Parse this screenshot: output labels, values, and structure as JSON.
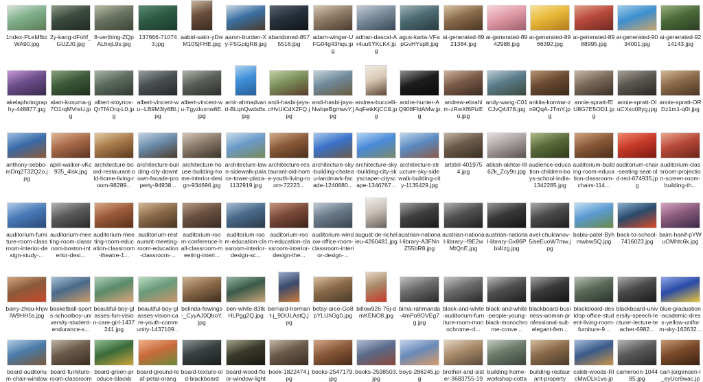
{
  "files": [
    {
      "name": "1ndex-PLeMfbzWA90.jpg",
      "colors": [
        "#7fb08a",
        "#d9e3d8",
        "#5e7b58"
      ]
    },
    {
      "name": "2y-kang-dFohf_GUZJ0.jpg",
      "colors": [
        "#3b4a3f",
        "#8d9c86",
        "#1f2a24"
      ]
    },
    {
      "name": "8-verthing-ZQpALhxjL9s.jpg",
      "colors": [
        "#6b7462",
        "#b9bca6",
        "#3c4436"
      ]
    },
    {
      "name": "137666-710743.jpg",
      "colors": [
        "#2e5b45",
        "#5a8a72",
        "#1b3b2d"
      ]
    },
    {
      "name": "aabid-sakir-yDwM10SjFHE.jpg",
      "colors": [
        "#6b4e3c",
        "#c8b79e",
        "#3b2b22"
      ],
      "tall": true
    },
    {
      "name": "aaron-burden-Xy-F5GptgR8.jpg",
      "colors": [
        "#3a6fa1",
        "#c8d8e6",
        "#4b3a2b"
      ]
    },
    {
      "name": "abandoned-8575516.jpg",
      "colors": [
        "#26313b",
        "#5a6570",
        "#0f1418"
      ]
    },
    {
      "name": "adam-winger-UFG04g43hqs.jpg",
      "colors": [
        "#8f7b66",
        "#d7c9b4",
        "#4a3b2e"
      ]
    },
    {
      "name": "adrian-dascal-Ar4uu5YKLK4.jpg",
      "colors": [
        "#7a8c9c",
        "#c3ccd4",
        "#394754"
      ]
    },
    {
      "name": "agus-karta-VFapGvHYsp8.jpg",
      "colors": [
        "#4d6b73",
        "#9fb3b7",
        "#27393d"
      ]
    },
    {
      "name": "ai-generated-8921384.jpg",
      "colors": [
        "#8a6b4c",
        "#d9c4a4",
        "#493522"
      ]
    },
    {
      "name": "ai-generated-8942988.jpg",
      "colors": [
        "#e09aa8",
        "#f5d6dc",
        "#9e5e6b"
      ]
    },
    {
      "name": "ai-generated-8966392.jpg",
      "colors": [
        "#e8b93a",
        "#f6e19a",
        "#b07a1c"
      ]
    },
    {
      "name": "ai-generated-8988995.jpg",
      "colors": [
        "#b94a3c",
        "#e3a08c",
        "#6e2a22"
      ]
    },
    {
      "name": "ai-generated-9034001.jpg",
      "colors": [
        "#3d8fd0",
        "#9fcde8",
        "#c8a46a"
      ]
    },
    {
      "name": "ai-generated-9214143.jpg",
      "colors": [
        "#4a6b3a",
        "#9ab07e",
        "#2c3d22"
      ]
    },
    {
      "name": "akelaphotography-448877.jpg",
      "colors": [
        "#6b4d8a",
        "#c79ad6",
        "#3b2a4e"
      ]
    },
    {
      "name": "alam-kusuma-g7O1rqMVreU.jpg",
      "colors": [
        "#3c5a3a",
        "#8aa47a",
        "#1f2e1c"
      ]
    },
    {
      "name": "albert-stoynov-QrTfAOrq-L0.jpg",
      "colors": [
        "#5c6a5e",
        "#a9b5a6",
        "#2e3830"
      ]
    },
    {
      "name": "albert-vincent-wu--LB9M3ly8BI.jpg",
      "colors": [
        "#4a4f52",
        "#9aa0a2",
        "#26292b"
      ]
    },
    {
      "name": "albert-vincent-wu-Tgyzloxnw6E.jpg",
      "colors": [
        "#5a5e58",
        "#b0b4aa",
        "#2b2e2a"
      ]
    },
    {
      "name": "amir-ahmadvand-BLqnQwds6s.jpg",
      "colors": [
        "#3f8fd8",
        "#a9d2f2",
        "#2a5f99"
      ],
      "tall": true
    },
    {
      "name": "andi-hasbi-jaya-cHvUiCdX2FQ.jpg",
      "colors": [
        "#7a8f5a",
        "#c5d1a6",
        "#5a3b2a"
      ]
    },
    {
      "name": "andi-hasbi-jaya-NwIqeBgmwvY.jpg",
      "colors": [
        "#6f8a9a",
        "#c6d4da",
        "#6a5a3e"
      ]
    },
    {
      "name": "andrea-buccelli-AqFetkKjCC8.jpg",
      "colors": [
        "#d9c8b4",
        "#f2ece4",
        "#5a4436"
      ],
      "tall": true
    },
    {
      "name": "andre-hunter-AQ908FfdAMw.jpg",
      "colors": [
        "#1c1c1c",
        "#8f8f8f",
        "#0a0a0a"
      ]
    },
    {
      "name": "andrew-ebrahim-zRwXf6PizEo.jpg",
      "colors": [
        "#7a5a48",
        "#cfb6a0",
        "#3a2a20"
      ]
    },
    {
      "name": "andy-wang-C01CJvQ4478.jpg",
      "colors": [
        "#5a7a8a",
        "#b8cbd4",
        "#3a4a3a"
      ]
    },
    {
      "name": "ankita-konwar-zn9QqA-JTmY.jpg",
      "colors": [
        "#6a4a32",
        "#b89470",
        "#3a2818"
      ]
    },
    {
      "name": "annie-spratt-fEU8G7E5OD1.jpg",
      "colors": [
        "#7a6a5a",
        "#cabaa8",
        "#3a2e24"
      ]
    },
    {
      "name": "annie-spratt-OIuCXxo08yg.jpg",
      "colors": [
        "#5a5650",
        "#a8a298",
        "#2a2622"
      ]
    },
    {
      "name": "annie-spratt-ORDz1m1-q0I.jpg",
      "colors": [
        "#8a6a4a",
        "#d4b896",
        "#4a3422"
      ]
    },
    {
      "name": "anthony-sebbo-mDrq2T32Q2o.jpg",
      "colors": [
        "#3a6aa8",
        "#9cc0e4",
        "#8a5a3a"
      ]
    },
    {
      "name": "april-walker-vKc935_4lsk.jpg",
      "colors": [
        "#a86a4a",
        "#e0b898",
        "#5a3422"
      ]
    },
    {
      "name": "architecture-board-restaurant-old-home-living-room-98289...",
      "colors": [
        "#a87a4a",
        "#e4cba4",
        "#5a3a1e"
      ]
    },
    {
      "name": "architecture-building-city-downtown-facade-property-94938...",
      "colors": [
        "#6a8aa8",
        "#c4d4e2",
        "#4a3a2a"
      ]
    },
    {
      "name": "architecture-house-building-home-interior-design-934696.jpg",
      "colors": [
        "#8a7a6a",
        "#d4c8b8",
        "#3a322a"
      ]
    },
    {
      "name": "architecture-lawn-sidewalk-palace-tower-plaza-1132919.jpg",
      "colors": [
        "#6a9ac8",
        "#c8dcec",
        "#7a8a5a"
      ]
    },
    {
      "name": "architecture-restaurant-old-home-youth-living-room-72223...",
      "colors": [
        "#8a5a3a",
        "#d4ae8a",
        "#4a2e1a"
      ]
    },
    {
      "name": "architecture-sky-building-chateau-landmark-facade-1240880...",
      "colors": [
        "#3a72c8",
        "#a6c8ee",
        "#6a5a4a"
      ]
    },
    {
      "name": "architecture-sky-building-city-skyscraper-cityscape-1346767...",
      "colors": [
        "#4a8ad8",
        "#b4d4f4",
        "#7a8a6a"
      ]
    },
    {
      "name": "architecture-structure-sky-sidewalk-building-city-1135429.jpg",
      "colors": [
        "#5a8ac0",
        "#c0d6ea",
        "#8a5a4a"
      ]
    },
    {
      "name": "artstel-4019754.jpg",
      "colors": [
        "#6a5a4a",
        "#c4b4a0",
        "#3a2e22"
      ]
    },
    {
      "name": "atikah-akhtar-I862k_Zcy9o.jpg",
      "colors": [
        "#a8a0a0",
        "#e4e0de",
        "#5a5050"
      ]
    },
    {
      "name": "audience-education-children-boys-school-india-1342285.jpg",
      "colors": [
        "#5a6a3a",
        "#aebc88",
        "#2e3a1a"
      ]
    },
    {
      "name": "auditorium-building-room-education-classroom-chairs-114...",
      "colors": [
        "#8a5a3a",
        "#d4a480",
        "#4a2c18"
      ]
    },
    {
      "name": "auditorium-chair-seating-seat-old-red-674935.jpg",
      "colors": [
        "#c83a2a",
        "#f08a6e",
        "#7a1a10"
      ]
    },
    {
      "name": "auditorium-classroom-projection-screen-room-building-th...",
      "colors": [
        "#b84a3a",
        "#e8a890",
        "#6a2418"
      ]
    },
    {
      "name": "auditorium-furniture-room-classroom-interior-design-study-...",
      "colors": [
        "#4a7ab8",
        "#b0cce8",
        "#2a4a78"
      ]
    },
    {
      "name": "auditorium-meeting-room-classroom-boston-interior-desi...",
      "colors": [
        "#5a5a5a",
        "#b4b4b4",
        "#2a2a2a"
      ]
    },
    {
      "name": "auditorium-meeting-room-education-classroom-theatre-1...",
      "colors": [
        "#9a5a3a",
        "#dca888",
        "#5a3018"
      ]
    },
    {
      "name": "auditorium-restaurant-meeting-room-education-classroom-...",
      "colors": [
        "#8a6a4a",
        "#d4b894",
        "#4a3420"
      ]
    },
    {
      "name": "auditorium-room-conference-hall-classroom-meeting-interi...",
      "colors": [
        "#6a5040",
        "#b89c88",
        "#3a2a20"
      ]
    },
    {
      "name": "auditorium-room-education-classroom-interior-design-sc...",
      "colors": [
        "#4a6a8a",
        "#a6bcd2",
        "#2a3a4a"
      ]
    },
    {
      "name": "auditorium-room-education-classroom-interior-design-the...",
      "colors": [
        "#7a4a3a",
        "#c8967e",
        "#3e2218"
      ]
    },
    {
      "name": "auditorium-window-office-room-classroom-interior-design-...",
      "colors": [
        "#6a7a8a",
        "#c0cad4",
        "#3a4450"
      ]
    },
    {
      "name": "august-de-richelieu-4260481.jpg",
      "colors": [
        "#c8c0b8",
        "#f0ece8",
        "#6a6058"
      ],
      "tall": true
    },
    {
      "name": "austrian-national-library-A3FNnZ55bR8.jpg",
      "colors": [
        "#404040",
        "#a0a0a0",
        "#1a1a1a"
      ]
    },
    {
      "name": "austrian-national-library--f9E2wMtQnE.jpg",
      "colors": [
        "#505050",
        "#b0b0b0",
        "#202020"
      ]
    },
    {
      "name": "austrian-national-library-Gx86Pbi4Izg.jpg",
      "colors": [
        "#383838",
        "#989898",
        "#141414"
      ]
    },
    {
      "name": "avel-chuklanov-5iseEuoW7mw.jpg",
      "colors": [
        "#4a4a4a",
        "#aaaaaa",
        "#1e1e1e"
      ]
    },
    {
      "name": "bablu-patel-ByhmwbwSQ.jpg",
      "colors": [
        "#5a9ad0",
        "#c4e0f4",
        "#6a8a4a"
      ]
    },
    {
      "name": "back-to-school-7416023.jpg",
      "colors": [
        "#2a4a6a",
        "#8ab0d0",
        "#d84a2a"
      ]
    },
    {
      "name": "baim-hanif-pYWuOMhtc6k.jpg",
      "colors": [
        "#8a5a7a",
        "#d8a6c4",
        "#3a2a4a"
      ]
    },
    {
      "name": "barry-zhou-khjwIW9HH5s.jpg",
      "colors": [
        "#8a5a3a",
        "#d4a884",
        "#c84a2a"
      ]
    },
    {
      "name": "basketball-sports-schoolboy-university-student-endurance-s...",
      "colors": [
        "#4a6a8a",
        "#a8c0d4",
        "#c89a6a"
      ]
    },
    {
      "name": "beautiful-boy-glasses-fun-vision-care-girl-1437241.jpg",
      "colors": [
        "#5a8a6a",
        "#b0d0b8",
        "#d8a478"
      ]
    },
    {
      "name": "beautiful-boy-glasses-vision-care-youth-community-1437109...",
      "colors": [
        "#6a9a7a",
        "#bcdcc4",
        "#c8946a"
      ]
    },
    {
      "name": "belinda-fewings-_CyyAJ0QboY.jpg",
      "colors": [
        "#8a6a4a",
        "#d0b494",
        "#3e2e1e"
      ]
    },
    {
      "name": "ben-white-83tkHLPgg2Q.jpg",
      "colors": [
        "#3a5a4a",
        "#94b4a4",
        "#c8a478"
      ]
    },
    {
      "name": "bernard-hermant-j_9DULAstQ.jpg",
      "colors": [
        "#3a4a6a",
        "#98a8c8",
        "#c87a3a"
      ],
      "tall": true
    },
    {
      "name": "betsy-arce-Go8pYLUhGg0.jpg",
      "colors": [
        "#8a6a4a",
        "#d8c0a0",
        "#4a3a2a"
      ]
    },
    {
      "name": "billow926-76j-dmKENO8.jpg",
      "colors": [
        "#a88a6a",
        "#e8d8c4",
        "#c83a2a"
      ],
      "tall": true
    },
    {
      "name": "bima-rahmanda-4mPo9OVEg7g.jpg",
      "colors": [
        "#6a6a6a",
        "#c0c0c0",
        "#2a2a2a"
      ]
    },
    {
      "name": "black-and-white-auditorium-furniture-room-monochrome-cl...",
      "colors": [
        "#6a6a6a",
        "#c4c4c4",
        "#2a2a2a"
      ]
    },
    {
      "name": "black-and-white-people-young-black-monochrome-conve...",
      "colors": [
        "#505050",
        "#b8b8b8",
        "#1e1e1e"
      ]
    },
    {
      "name": "blackboard-business-woman-professional-suit-elegant-fem...",
      "colors": [
        "#3a3a3a",
        "#a0a0a0",
        "#141414"
      ]
    },
    {
      "name": "blackboard-desktop-office-student-living-room-furniture-9...",
      "colors": [
        "#5a6a5a",
        "#b4c0b4",
        "#2a322a"
      ]
    },
    {
      "name": "blackboard-university-speech-lecturer-lecture-teacher-6982...",
      "colors": [
        "#4a4a4a",
        "#aaaaaa",
        "#1a1a1a"
      ]
    },
    {
      "name": "blue-graduation-academic-dress-yellow-uniform-sky-162632...",
      "colors": [
        "#2a4aa8",
        "#90a8e4",
        "#e8c43a"
      ]
    },
    {
      "name": "board-auditorium-chair-window",
      "colors": [
        "#4a7aa8",
        "#b0cce4",
        "#7a5a3a"
      ]
    },
    {
      "name": "board-furniture-room-classroom",
      "colors": [
        "#6a5a4a",
        "#c0b4a4",
        "#3a2e22"
      ]
    },
    {
      "name": "board-green-produce-blackb",
      "colors": [
        "#3a6a3a",
        "#94c094",
        "#c8a43a"
      ]
    },
    {
      "name": "board-ground-leaf-petal-orang",
      "colors": [
        "#c86a3a",
        "#f0b08a",
        "#6a8a3a"
      ]
    },
    {
      "name": "board-texture-old-blackboard",
      "colors": [
        "#3a4040",
        "#8a9494",
        "#1a1e1e"
      ]
    },
    {
      "name": "board-wood-floor-window-light",
      "colors": [
        "#3a3a2a",
        "#a4a48a",
        "#181812"
      ]
    },
    {
      "name": "book-1822474.jpg",
      "colors": [
        "#6a5a4a",
        "#c4b4a4",
        "#3a2e22"
      ]
    },
    {
      "name": "books-2547179.jpg",
      "colors": [
        "#8a5a3a",
        "#d4a88a",
        "#4a2a18"
      ]
    },
    {
      "name": "books-2598503.jpg",
      "colors": [
        "#5a6a8a",
        "#b0bcd4",
        "#8a4a3a"
      ]
    },
    {
      "name": "boys-286245.jpg",
      "colors": [
        "#6a8ab8",
        "#c4d4ec",
        "#d89a6a"
      ]
    },
    {
      "name": "brother-and-sister-3683755-19",
      "colors": [
        "#a88a6a",
        "#e4d4c0",
        "#5a4a3a"
      ]
    },
    {
      "name": "building-home-workshop-cotta",
      "colors": [
        "#6a7a6a",
        "#c0ccc0",
        "#3a423a"
      ]
    },
    {
      "name": "building-restaurant-property",
      "colors": [
        "#8a6a4a",
        "#d4bc9c",
        "#4a3a2a"
      ]
    },
    {
      "name": "caleb-woods-RIcMwDLk1vo.jp",
      "colors": [
        "#3a5a8a",
        "#a4bcdc",
        "#c8944a"
      ]
    },
    {
      "name": "cameroon-104485.jpg",
      "colors": [
        "#5a5a5a",
        "#b4b4b4",
        "#2a2a2a"
      ]
    },
    {
      "name": "carl-jorgensen-l_eyUcr6wac.jp",
      "colors": [
        "#7a4a2a",
        "#c89a74",
        "#3a2212"
      ]
    }
  ]
}
